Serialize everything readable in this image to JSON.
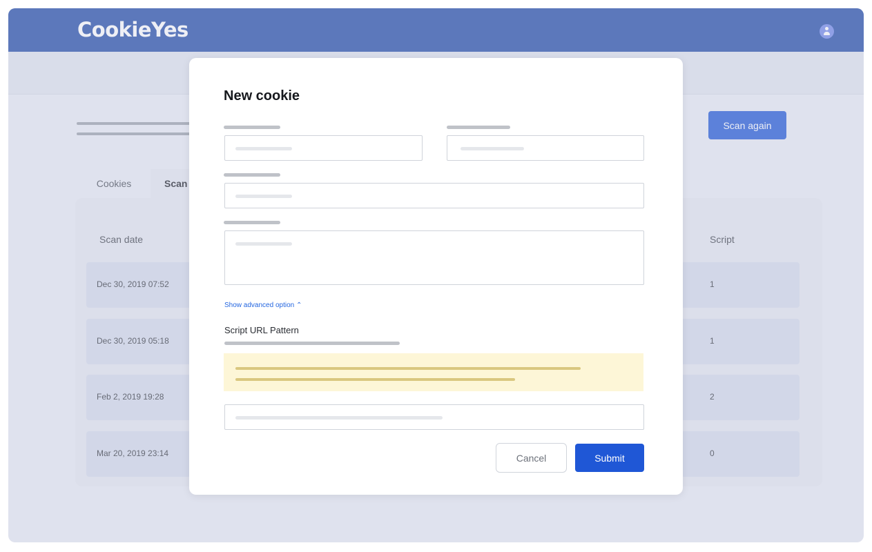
{
  "app": {
    "logo_text": "CookieYes",
    "brand_color": "#1f49a6",
    "accent_color": "#1f57d6"
  },
  "header": {
    "avatar_icon": "user-icon"
  },
  "toolbar": {
    "scan_again_label": "Scan again"
  },
  "tabs": [
    {
      "label": "Cookies",
      "active": false
    },
    {
      "label": "Scan",
      "active": true
    }
  ],
  "table": {
    "columns": {
      "scan_date": "Scan date",
      "script": "Script"
    },
    "rows": [
      {
        "date": "Dec 30, 2019 07:52",
        "script": "1"
      },
      {
        "date": "Dec 30, 2019 05:18",
        "script": "1"
      },
      {
        "date": "Feb 2, 2019 19:28",
        "script": "2"
      },
      {
        "date": "Mar 20, 2019 23:14",
        "script": "0"
      }
    ]
  },
  "modal": {
    "title": "New cookie",
    "advanced_link": "Show advanced option ⌃",
    "script_url_label": "Script URL Pattern",
    "notice_color": "#fdf6d7",
    "cancel_label": "Cancel",
    "submit_label": "Submit"
  }
}
